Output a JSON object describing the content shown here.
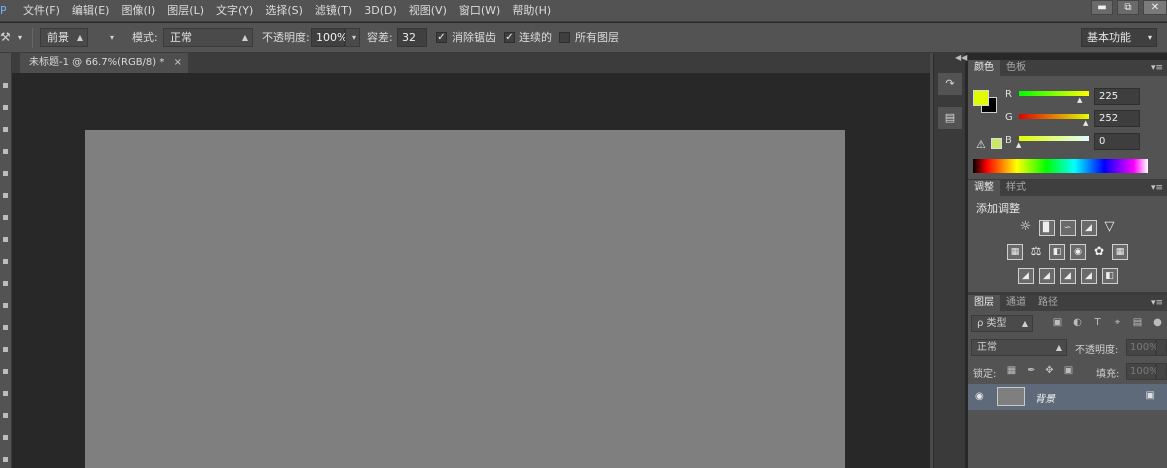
{
  "app": {
    "logo": "Ps"
  },
  "menubar": {
    "items": [
      "文件(F)",
      "编辑(E)",
      "图像(I)",
      "图层(L)",
      "文字(Y)",
      "选择(S)",
      "滤镜(T)",
      "3D(D)",
      "视图(V)",
      "窗口(W)",
      "帮助(H)"
    ]
  },
  "window_controls": {
    "minimize": "▬",
    "restore": "⧉",
    "close": "✕"
  },
  "options": {
    "fill_source": "前景",
    "mode_label": "模式:",
    "mode_value": "正常",
    "opacity_label": "不透明度:",
    "opacity_value": "100%",
    "tolerance_label": "容差:",
    "tolerance_value": "32",
    "antialias_label": "消除锯齿",
    "antialias_checked": true,
    "contiguous_label": "连续的",
    "contiguous_checked": true,
    "all_layers_label": "所有图层",
    "all_layers_checked": false,
    "workspace": "基本功能"
  },
  "document": {
    "tab_title": "未标题-1 @ 66.7%(RGB/8) *",
    "close_glyph": "×",
    "canvas_color": "#7f7f7f"
  },
  "color_panel": {
    "tabs": [
      "颜色",
      "色板"
    ],
    "active_tab": 0,
    "foreground": "#e1fc00",
    "background": "#000000",
    "channels": [
      {
        "name": "R",
        "value": "225"
      },
      {
        "name": "G",
        "value": "252"
      },
      {
        "name": "B",
        "value": "0"
      }
    ]
  },
  "adjustments_panel": {
    "tabs": [
      "调整",
      "样式"
    ],
    "active_tab": 0,
    "title": "添加调整"
  },
  "layers_panel": {
    "tabs": [
      "图层",
      "通道",
      "路径"
    ],
    "active_tab": 0,
    "kind_filter": "ρ 类型",
    "blend_mode": "正常",
    "opacity_label": "不透明度:",
    "opacity_value": "100%",
    "lock_label": "锁定:",
    "fill_label": "填充:",
    "fill_value": "100%",
    "layers": [
      {
        "name": "背景",
        "visible": true,
        "locked": true
      }
    ]
  }
}
